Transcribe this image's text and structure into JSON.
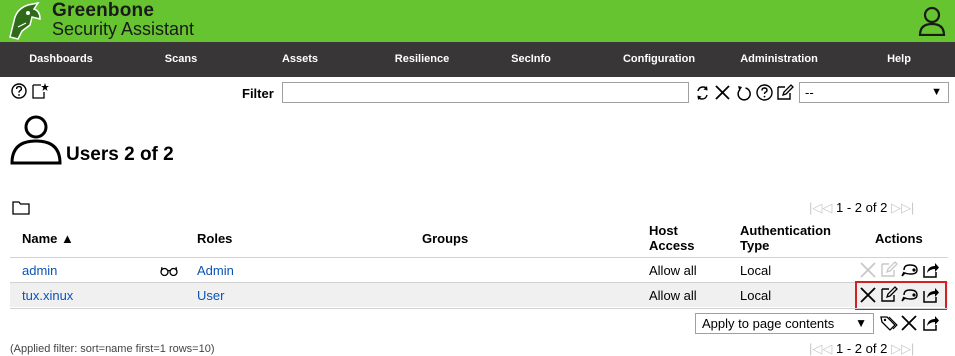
{
  "app": {
    "brand_line1": "Greenbone",
    "brand_line2": "Security Assistant"
  },
  "menu": [
    {
      "label": "Dashboards"
    },
    {
      "label": "Scans"
    },
    {
      "label": "Assets"
    },
    {
      "label": "Resilience"
    },
    {
      "label": "SecInfo"
    },
    {
      "label": "Configuration"
    },
    {
      "label": "Administration"
    },
    {
      "label": "Help"
    }
  ],
  "toolbar": {
    "filter_label": "Filter",
    "filter_value": "",
    "filter_select_value": "--"
  },
  "page": {
    "title": "Users 2 of 2"
  },
  "pager": {
    "top_text": "1 - 2 of 2",
    "bottom_text": "1 - 2 of 2"
  },
  "table": {
    "headers": {
      "name": "Name ▲",
      "roles": "Roles",
      "groups": "Groups",
      "host_access_1": "Host",
      "host_access_2": "Access",
      "auth_type_1": "Authentication",
      "auth_type_2": "Type",
      "actions": "Actions"
    },
    "rows": [
      {
        "name": "admin",
        "roles": "Admin",
        "groups": "",
        "host_access": "Allow all",
        "auth_type": "Local"
      },
      {
        "name": "tux.xinux",
        "roles": "User",
        "groups": "",
        "host_access": "Allow all",
        "auth_type": "Local"
      }
    ]
  },
  "footer": {
    "apply_select_value": "Apply to page contents",
    "applied_filter": "(Applied filter: sort=name first=1 rows=10)"
  },
  "colors": {
    "header_green": "#66c430",
    "menu_dark": "#393637",
    "link_blue": "#0a53b7",
    "highlight_red": "#d62020"
  }
}
